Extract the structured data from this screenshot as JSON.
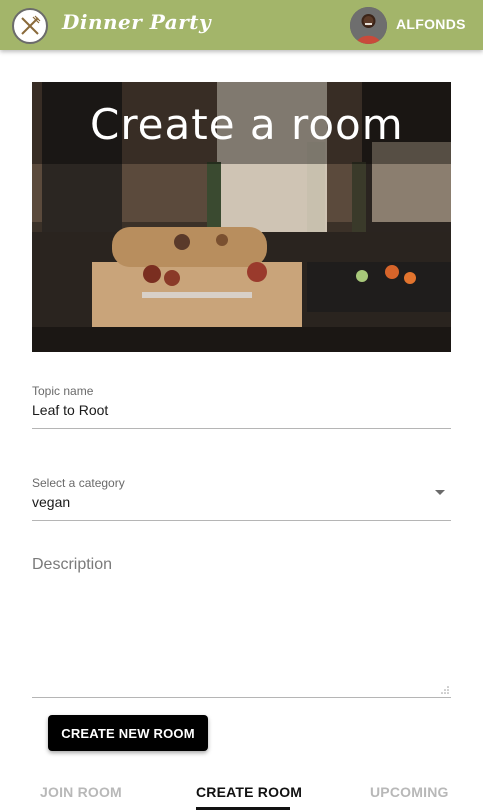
{
  "header": {
    "brand": "Dinner Party",
    "username": "ALFONDS"
  },
  "hero": {
    "title": "Create a room"
  },
  "form": {
    "topic": {
      "label": "Topic name",
      "value": "Leaf to Root"
    },
    "category": {
      "label": "Select a category",
      "value": "vegan"
    },
    "description": {
      "placeholder": "Description"
    },
    "submit_label": "CREATE NEW ROOM"
  },
  "tabs": [
    {
      "label": "JOIN ROOM",
      "active": false
    },
    {
      "label": "CREATE ROOM",
      "active": true
    },
    {
      "label": "UPCOMING",
      "active": false
    }
  ],
  "colors": {
    "appbar": "#a3b56a",
    "button": "#000000",
    "tab_inactive": "#b8b8b8",
    "tab_active": "#111111"
  }
}
